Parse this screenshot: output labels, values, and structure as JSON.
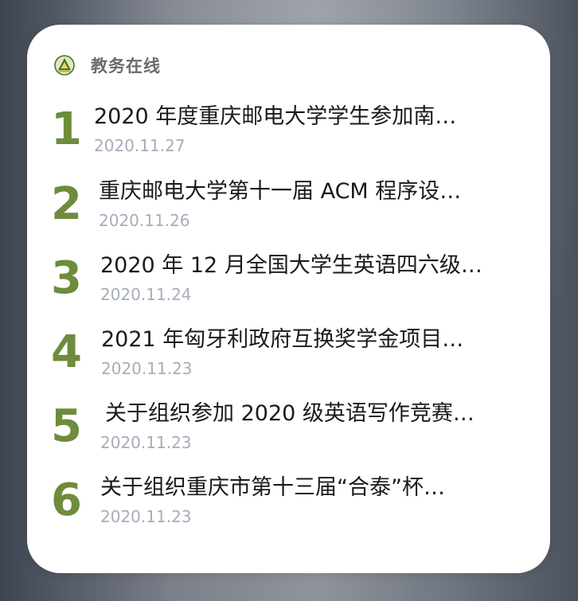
{
  "widget": {
    "app_name": "教务在线",
    "logo_icon": "school-emblem-icon",
    "accent_color": "#6e8c3c",
    "items": [
      {
        "rank": "1",
        "title": "2020 年度重庆邮电大学学生参加南…",
        "date": "2020.11.27"
      },
      {
        "rank": "2",
        "title": "重庆邮电大学第十一届 ACM 程序设…",
        "date": "2020.11.26"
      },
      {
        "rank": "3",
        "title": "2020 年 12 月全国大学生英语四六级…",
        "date": "2020.11.24"
      },
      {
        "rank": "4",
        "title": "2021 年匈牙利政府互换奖学金项目…",
        "date": "2020.11.23"
      },
      {
        "rank": "5",
        "title": "关于组织参加 2020 级英语写作竞赛…",
        "date": "2020.11.23"
      },
      {
        "rank": "6",
        "title": "关于组织重庆市第十三届“合泰”杯…",
        "date": "2020.11.23"
      }
    ]
  }
}
